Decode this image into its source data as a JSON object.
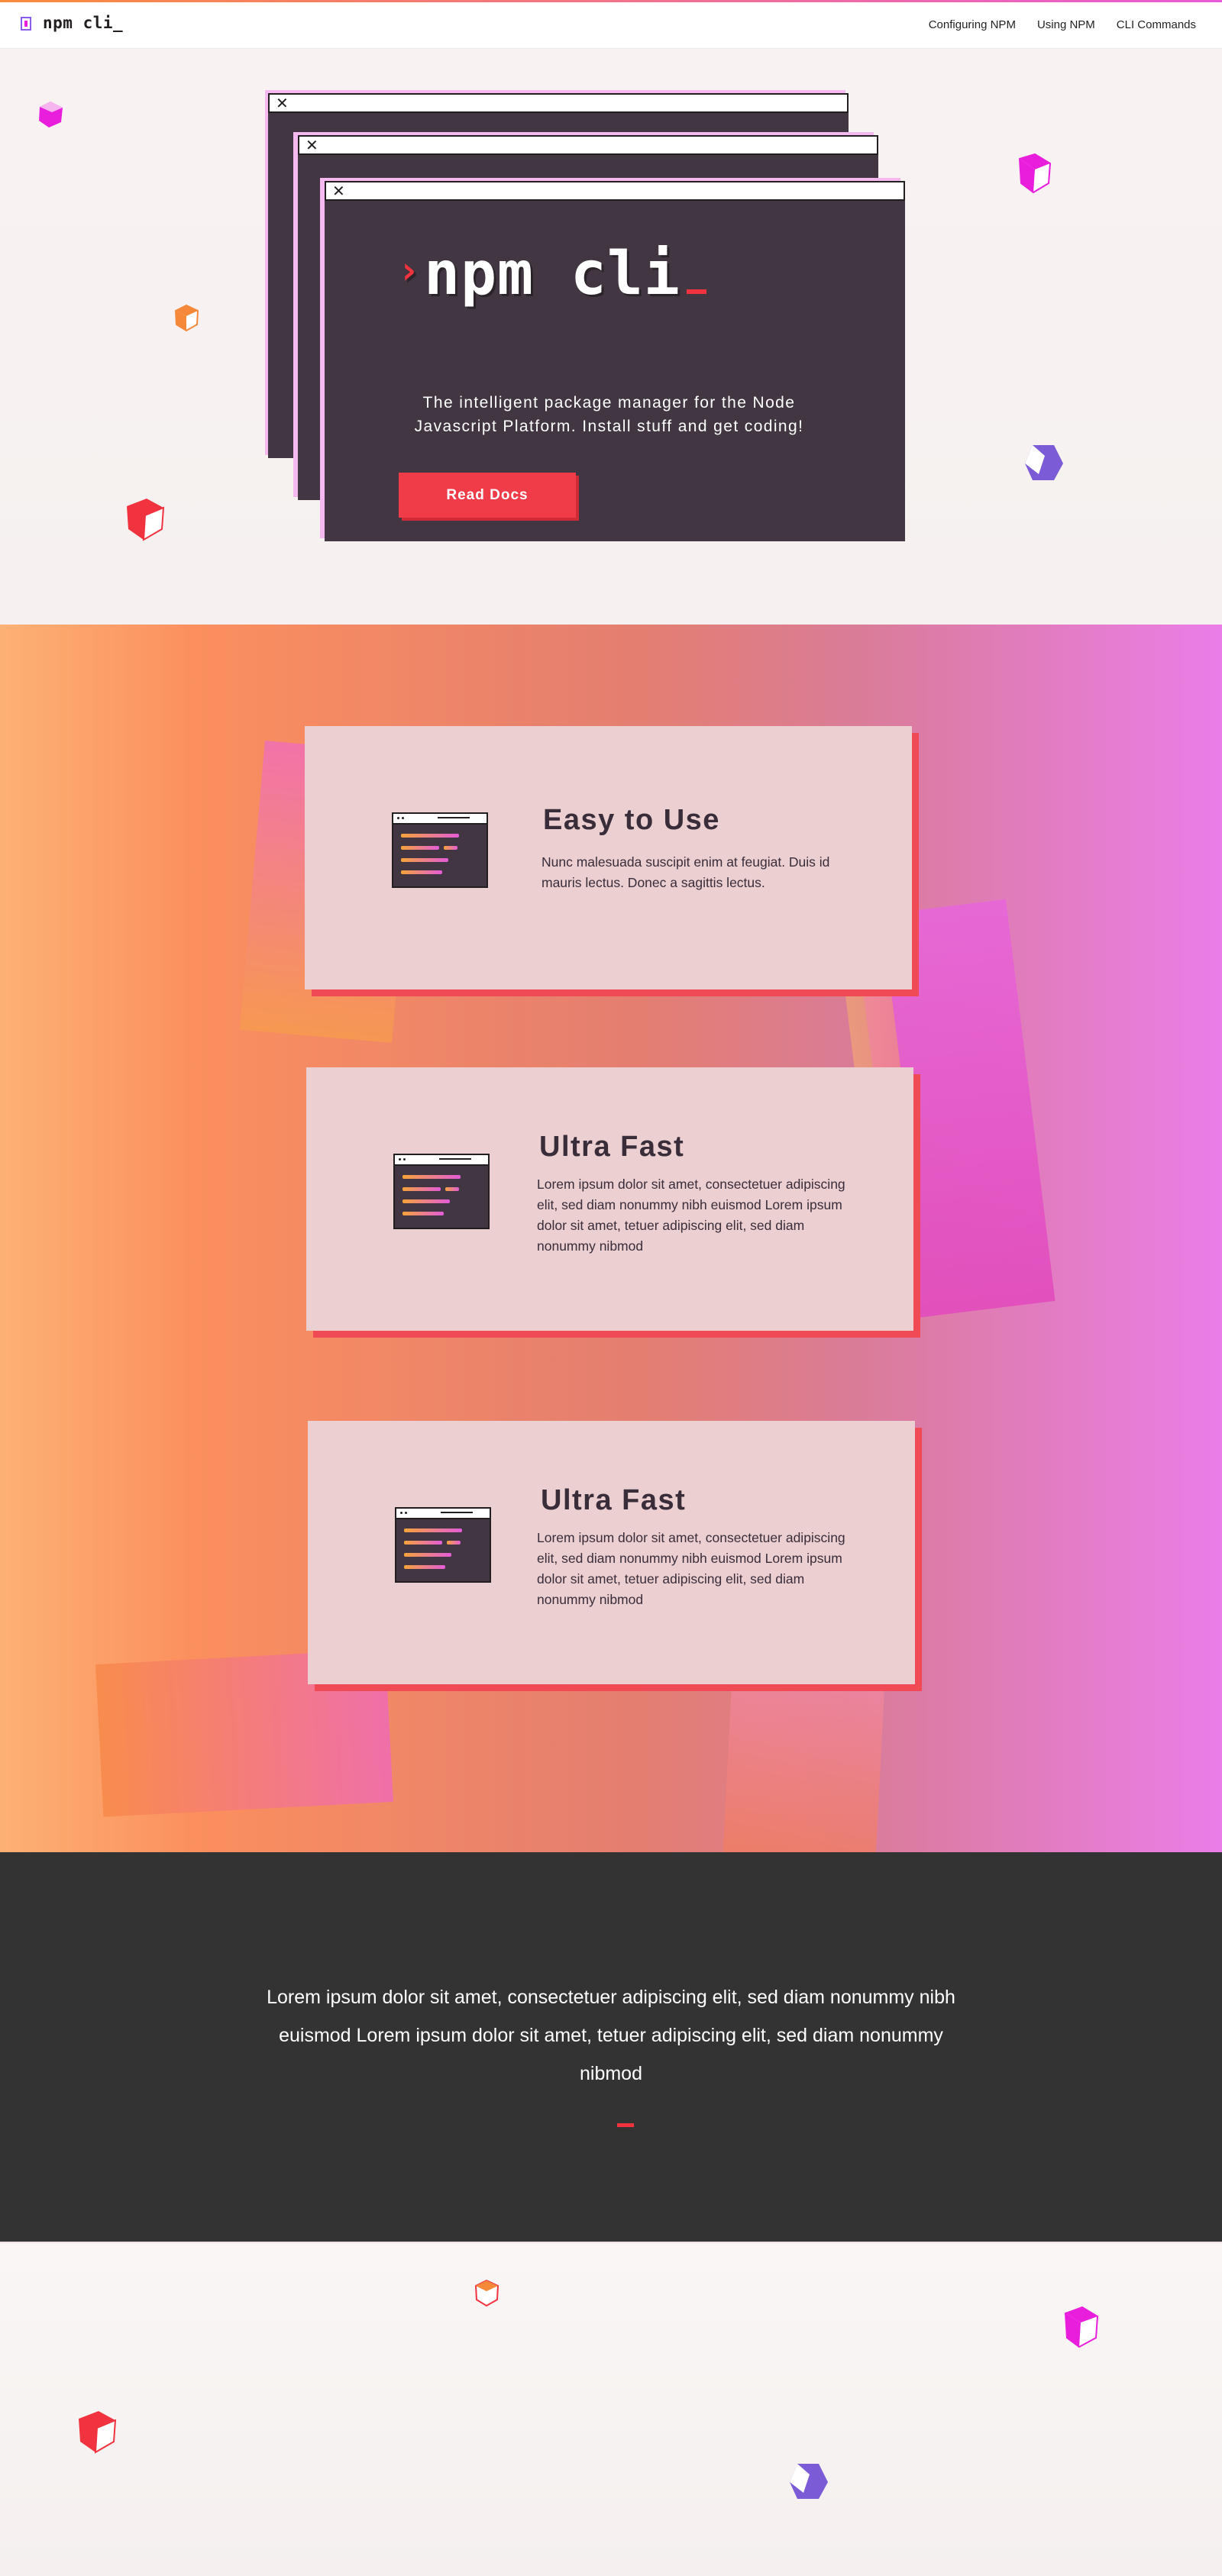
{
  "nav": {
    "brand": "npm cli_",
    "links": [
      "Configuring NPM",
      "Using NPM",
      "CLI Commands"
    ]
  },
  "hero": {
    "title": "npm cli",
    "description": "The intelligent package manager for the Node Javascript Platform. Install stuff and get coding!",
    "button_label": "Read Docs",
    "window_close_glyph": "✕"
  },
  "features": [
    {
      "icon": "terminal-window-icon",
      "title": "Easy to Use",
      "text": "Nunc malesuada suscipit enim at feugiat. Duis id mauris lectus. Donec a sagittis lectus."
    },
    {
      "icon": "terminal-window-icon",
      "title": "Ultra Fast",
      "text": "Lorem ipsum dolor sit amet, consectetuer adipiscing elit, sed diam nonummy nibh euismod Lorem ipsum dolor sit amet, tetuer adipiscing elit, sed diam nonummy nibmod"
    },
    {
      "icon": "terminal-window-icon",
      "title": "Ultra Fast",
      "text": "Lorem ipsum dolor sit amet, consectetuer adipiscing elit, sed diam nonummy nibh euismod Lorem ipsum dolor sit amet, tetuer adipiscing elit, sed diam nonummy nibmod"
    }
  ],
  "banner": {
    "text": "Lorem ipsum dolor sit amet, consectetuer adipiscing elit, sed diam nonummy nibh euismod Lorem ipsum dolor sit amet, tetuer adipiscing elit, sed diam nonummy nibmod"
  },
  "colors": {
    "accent": "#f03c48",
    "window": "#413641",
    "dark": "#333333",
    "magenta": "#e91edc",
    "orange": "#f6883a",
    "purple": "#7b5bd6"
  }
}
